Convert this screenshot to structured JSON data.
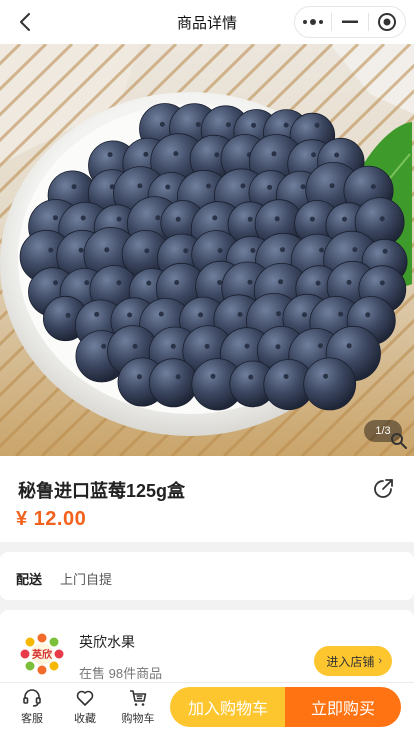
{
  "navbar": {
    "title": "商品详情",
    "back_icon": "chevron-left-icon",
    "more_icon": "more-dots-icon",
    "minimize_icon": "minus-icon",
    "close_icon": "target-circle-icon"
  },
  "gallery": {
    "counter": "1/3",
    "zoom_icon": "magnifier-icon"
  },
  "product": {
    "name": "秘鲁进口蓝莓125g盒",
    "price": "¥ 12.00",
    "share_icon": "share-icon"
  },
  "delivery": {
    "label": "配送",
    "value": "上门自提"
  },
  "shop": {
    "name": "英欣水果",
    "meta": "在售 98件商品",
    "enter_label": "进入店铺",
    "logo_text": "英欣"
  },
  "bottom_bar": {
    "service_label": "客服",
    "favorite_label": "收藏",
    "cart_label": "购物车",
    "add_to_cart_label": "加入购物车",
    "buy_now_label": "立即购买"
  },
  "colors": {
    "price": "#f2621d",
    "add_to_cart": "#fdc62f",
    "buy_now": "#ff7312"
  }
}
